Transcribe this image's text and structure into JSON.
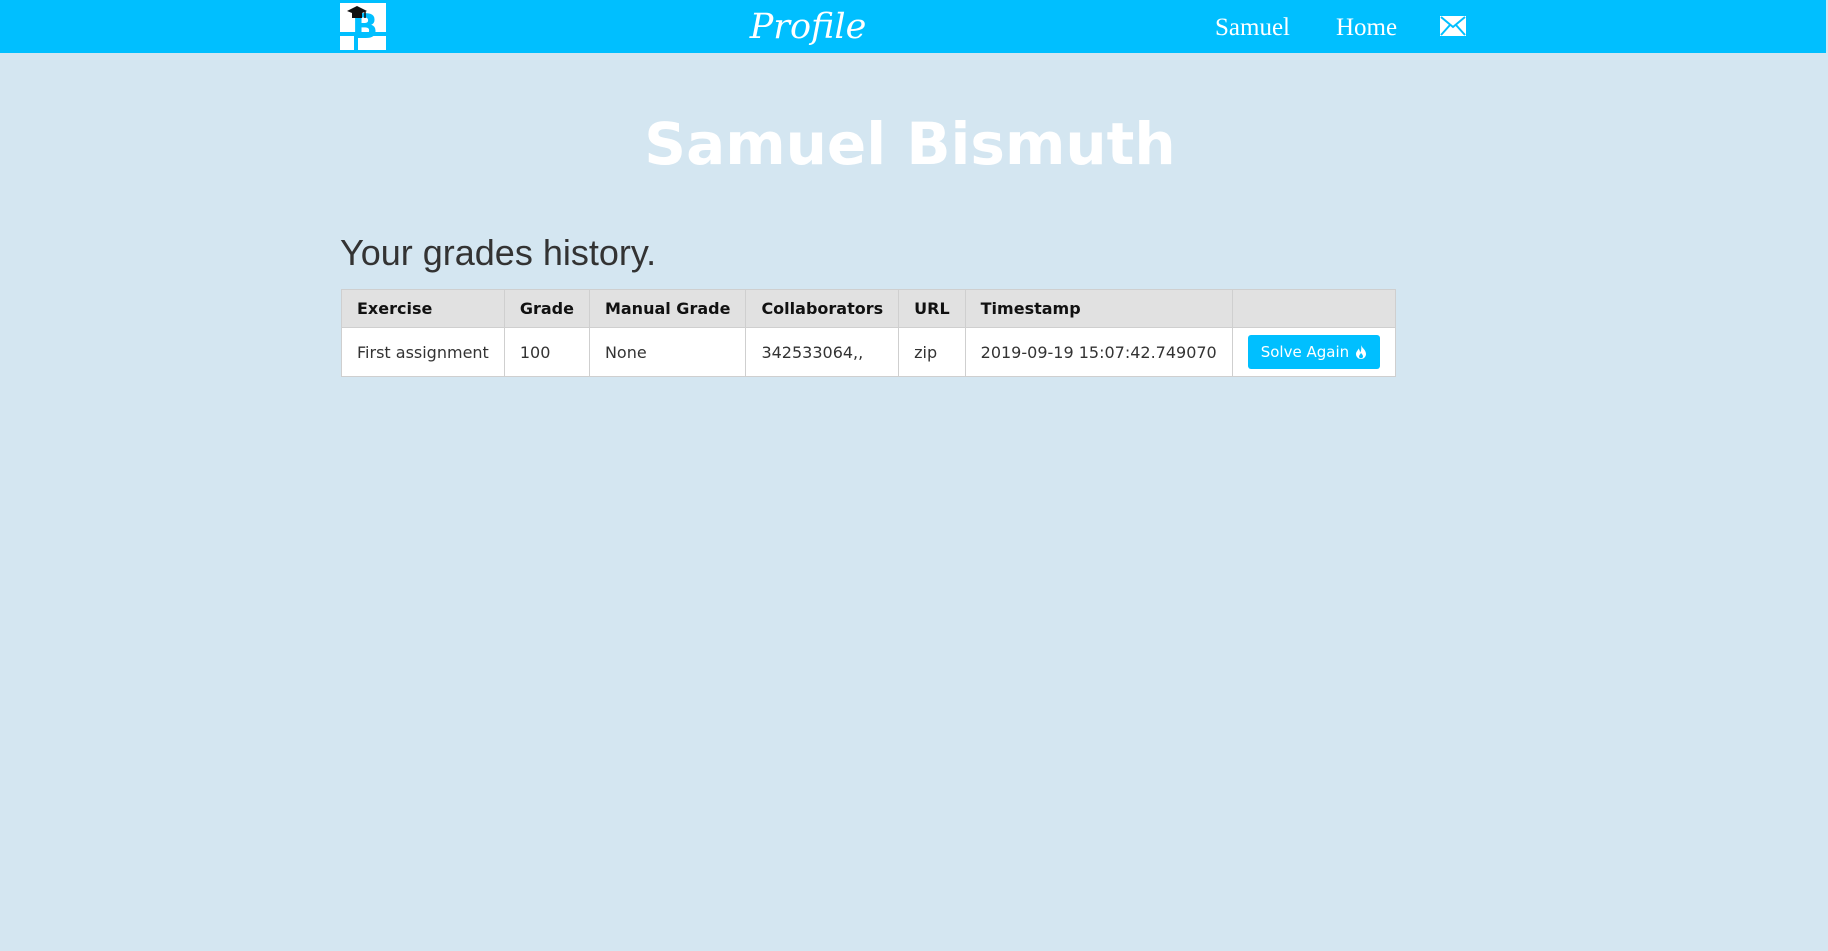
{
  "header": {
    "page_title": "Profile",
    "nav": {
      "user_label": "Samuel",
      "home_label": "Home"
    },
    "icons": {
      "logo": "site-logo-icon",
      "mail": "envelope-icon"
    },
    "colors": {
      "accent": "#00bfff",
      "background": "#d4e6f1"
    }
  },
  "profile": {
    "name": "Samuel Bismuth"
  },
  "grades": {
    "heading": "Your grades history.",
    "columns": [
      "Exercise",
      "Grade",
      "Manual Grade",
      "Collaborators",
      "URL",
      "Timestamp",
      ""
    ],
    "rows": [
      {
        "exercise": "First assignment",
        "grade": "100",
        "manual_grade": "None",
        "collaborators": "342533064,,",
        "url": "zip",
        "timestamp": "2019-09-19 15:07:42.749070",
        "action_label": "Solve Again",
        "action_icon": "flame-icon"
      }
    ]
  }
}
